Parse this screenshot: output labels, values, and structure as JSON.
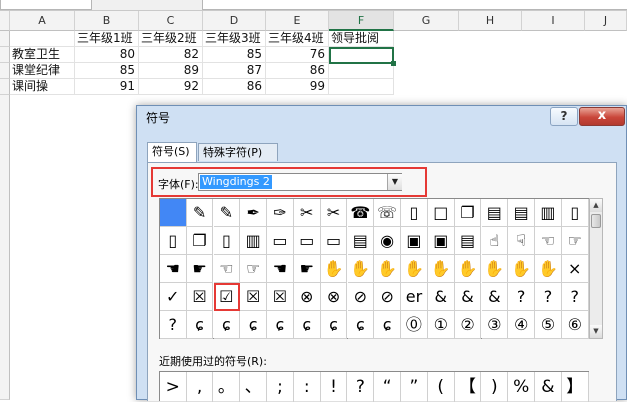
{
  "columns": [
    "A",
    "B",
    "C",
    "D",
    "E",
    "F",
    "G",
    "H",
    "I",
    "J"
  ],
  "rows": [
    {
      "label": "",
      "b": "三年级1班",
      "c": "三年级2班",
      "d": "三年级3班",
      "e": "三年级4班",
      "f": "领导批阅"
    },
    {
      "label": "教室卫生",
      "b": "80",
      "c": "82",
      "d": "85",
      "e": "76",
      "f": ""
    },
    {
      "label": "课堂纪律",
      "b": "85",
      "c": "89",
      "d": "87",
      "e": "86",
      "f": ""
    },
    {
      "label": "课间操",
      "b": "91",
      "c": "92",
      "d": "86",
      "e": "99",
      "f": ""
    }
  ],
  "dialog": {
    "title": "符号",
    "help": "?",
    "close": "x",
    "tabs": [
      "符号(S)",
      "特殊字符(P)"
    ],
    "font_label": "字体(F):",
    "font_value": "Wingdings 2",
    "recent_label": "近期使用过的符号(R):"
  },
  "symbols": [
    [
      "",
      "✎",
      "✎",
      "✒",
      "✑",
      "✂",
      "✂",
      "☎",
      "☏",
      "▯",
      "□",
      "❐",
      "▤",
      "▤",
      "▥",
      "▯"
    ],
    [
      "▯",
      "❐",
      "▯",
      "▥",
      "▭",
      "▭",
      "▭",
      "▤",
      "◉",
      "▣",
      "▣",
      "▤",
      "☝",
      "☟",
      "☜",
      "☞"
    ],
    [
      "☚",
      "☛",
      "☜",
      "☞",
      "☚",
      "☛",
      "✋",
      "✋",
      "✋",
      "✋",
      "✋",
      "✋",
      "✋",
      "✋",
      "✋",
      "×"
    ],
    [
      "✓",
      "☒",
      "☑",
      "☒",
      "☒",
      "⊗",
      "⊗",
      "⊘",
      "⊘",
      "er",
      "&",
      "&",
      "&",
      "?",
      "?",
      "?"
    ],
    [
      "?",
      "ɕ",
      "ɕ",
      "ɕ",
      "ɕ",
      "ɕ",
      "ɕ",
      "ɕ",
      "ɕ",
      "⓪",
      "①",
      "②",
      "③",
      "④",
      "⑤",
      "⑥"
    ]
  ],
  "recent_symbols": [
    ">",
    ",",
    "。",
    "、",
    ";",
    ":",
    "!",
    "?",
    "“",
    "”",
    "(",
    "【",
    ")",
    "%",
    "&",
    "】"
  ],
  "colors": {
    "accent": "#217346",
    "highlight": "#e53935",
    "selected": "#4287f5"
  }
}
